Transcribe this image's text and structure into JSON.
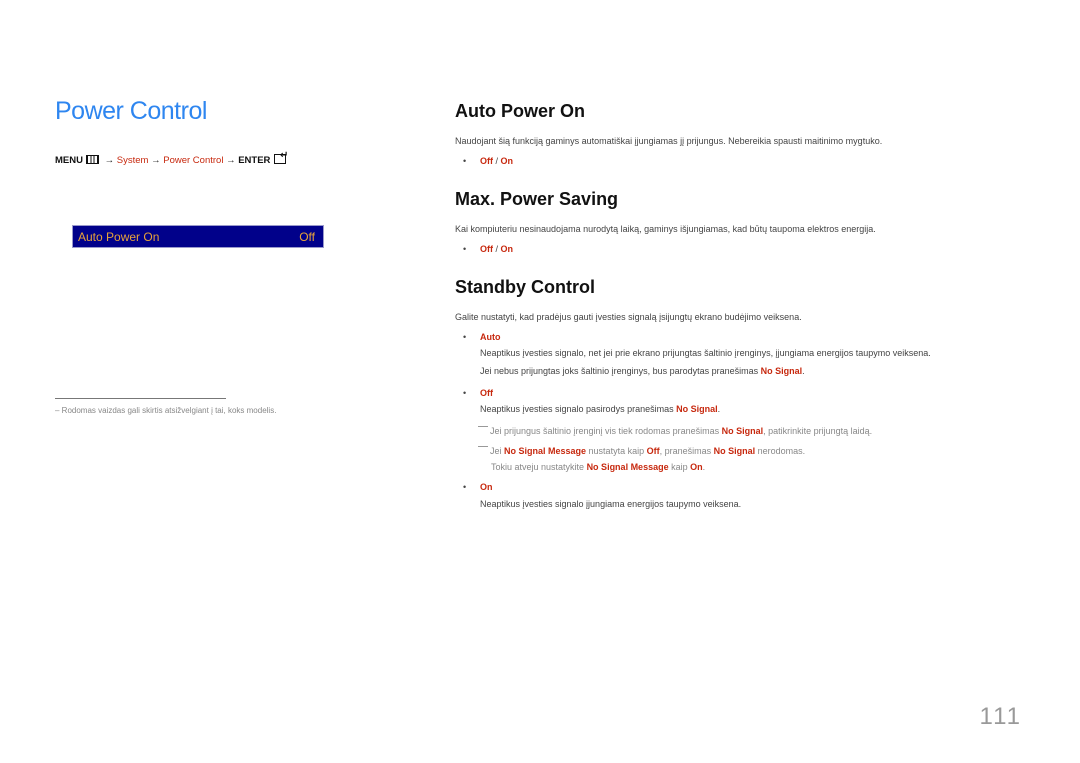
{
  "left": {
    "title": "Power Control",
    "menu_path": {
      "menu": "MENU",
      "arrow": "→",
      "system": "System",
      "power_control": "Power Control",
      "enter": "ENTER",
      "icons": [
        "menu-grid-icon",
        "enter-icon"
      ]
    },
    "osd": {
      "label": "Auto Power On",
      "value": "Off",
      "bg_color": "#01018a",
      "text_color": "#e8a33a"
    },
    "footnote": "Rodomas vaizdas gali skirtis atsižvelgiant į tai, koks modelis."
  },
  "sections": {
    "auto_power_on": {
      "heading": "Auto Power On",
      "desc": "Naudojant šią funkciją gaminys automatiškai įjungiamas jį prijungus. Nebereikia spausti maitinimo mygtuko.",
      "options": {
        "off": "Off",
        "sep": " / ",
        "on": "On"
      }
    },
    "max_power_saving": {
      "heading": "Max. Power Saving",
      "desc": "Kai kompiuteriu nesinaudojama nurodytą laiką, gaminys išjungiamas, kad būtų taupoma elektros energija.",
      "options": {
        "off": "Off",
        "sep": " / ",
        "on": "On"
      }
    },
    "standby_control": {
      "heading": "Standby Control",
      "desc": "Galite nustatyti, kad pradėjus gauti įvesties signalą įsijungtų ekrano budėjimo veiksena.",
      "auto": {
        "label": "Auto",
        "line1": "Neaptikus įvesties signalo, net jei prie ekrano prijungtas šaltinio įrenginys, įjungiama energijos taupymo veiksena.",
        "line2_pre": "Jei nebus prijungtas joks šaltinio įrenginys, bus parodytas pranešimas ",
        "line2_hl": "No Signal",
        "line2_post": "."
      },
      "off": {
        "label": "Off",
        "line1_pre": "Neaptikus įvesties signalo pasirodys pranešimas ",
        "line1_hl": "No Signal",
        "line1_post": ".",
        "note1_pre": "Jei prijungus šaltinio įrenginį vis tiek rodomas pranešimas ",
        "note1_hl": "No Signal",
        "note1_post": ", patikrinkite prijungtą laidą.",
        "note2_a": "Jei ",
        "note2_hl1": "No Signal Message",
        "note2_b": " nustatyta kaip ",
        "note2_hl2": "Off",
        "note2_c": ", pranešimas ",
        "note2_hl3": "No Signal",
        "note2_d": " nerodomas.",
        "note3_a": "Tokiu atveju nustatykite ",
        "note3_hl1": "No Signal Message",
        "note3_b": " kaip ",
        "note3_hl2": "On",
        "note3_c": "."
      },
      "on": {
        "label": "On",
        "line1": "Neaptikus įvesties signalo įjungiama energijos taupymo veiksena."
      }
    }
  },
  "page_number": "111",
  "colors": {
    "title_blue": "#2e86f0",
    "highlight_red": "#c7290f"
  },
  "bullet": "•"
}
